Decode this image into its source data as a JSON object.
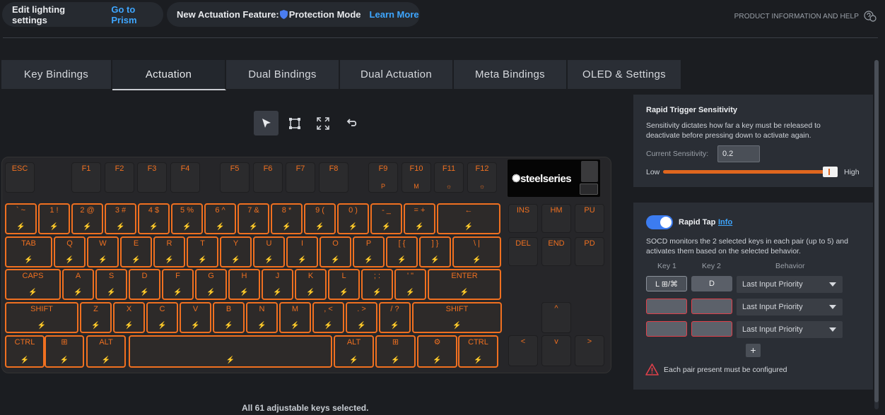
{
  "banner": {
    "lighting_text": "Edit lighting settings",
    "lighting_link": "Go to Prism",
    "feature_prefix": "New Actuation Feature:",
    "feature_name": "Protection Mode",
    "feature_link": "Learn More",
    "help_text": "PRODUCT INFORMATION AND HELP"
  },
  "tabs": [
    {
      "label": "Key Bindings",
      "active": false
    },
    {
      "label": "Actuation",
      "active": true
    },
    {
      "label": "Dual Bindings",
      "active": false
    },
    {
      "label": "Dual Actuation",
      "active": false
    },
    {
      "label": "Meta Bindings",
      "active": false
    },
    {
      "label": "OLED & Settings",
      "active": false
    }
  ],
  "toolbar": [
    "select-pointer-icon",
    "box-select-icon",
    "expand-select-icon",
    "undo-icon"
  ],
  "keyboard": {
    "oled_logo": "steelseries",
    "fn_row": [
      "ESC",
      "F1",
      "F2",
      "F3",
      "F4",
      "F5",
      "F6",
      "F7",
      "F8",
      "F9",
      "F10",
      "F11",
      "F12"
    ],
    "fn_sub": {
      "F9": "P",
      "F10": "M",
      "F11": "☼",
      "F12": "☼"
    },
    "nav_keys": [
      "INS",
      "HM",
      "PU",
      "DEL",
      "END",
      "PD"
    ],
    "row1": [
      "` ~",
      "1 !",
      "2 @",
      "3 #",
      "4 $",
      "5 %",
      "6 ^",
      "7 &",
      "8 *",
      "9 (",
      "0 )",
      "- _",
      "= +",
      "←"
    ],
    "row2": [
      "TAB",
      "Q",
      "W",
      "E",
      "R",
      "T",
      "Y",
      "U",
      "I",
      "O",
      "P",
      "[ {",
      "] }",
      "\\ |"
    ],
    "row3": [
      "CAPS",
      "A",
      "S",
      "D",
      "F",
      "G",
      "H",
      "J",
      "K",
      "L",
      "; :",
      "' \"",
      "ENTER"
    ],
    "row4": [
      "SHIFT",
      "Z",
      "X",
      "C",
      "V",
      "B",
      "N",
      "M",
      ", <",
      ". >",
      "/ ?",
      "SHIFT"
    ],
    "row5": [
      "CTRL",
      "⊞",
      "ALT",
      "",
      "ALT",
      "⊞",
      "⚙",
      "CTRL"
    ],
    "arrows": [
      "^",
      "<",
      "v",
      ">"
    ],
    "bolt": "⚡"
  },
  "status_text": "All 61 adjustable keys selected.",
  "rapid_trigger": {
    "title": "Rapid Trigger Sensitivity",
    "description": "Sensitivity dictates how far a key must be released to deactivate before pressing down to activate again.",
    "current_label": "Current Sensitivity:",
    "current_value": "0.2",
    "low_label": "Low",
    "high_label": "High",
    "slider_level": 0.92
  },
  "rapid_tap": {
    "enabled": true,
    "title": "Rapid Tap",
    "info_link": "Info",
    "description": "SOCD monitors the 2 selected keys in each pair (up to 5) and activates them based on the selected behavior.",
    "headers": {
      "key1": "Key 1",
      "key2": "Key 2",
      "behavior": "Behavior"
    },
    "pairs": [
      {
        "key1": "L ⊞/⌘",
        "key2": "D",
        "behavior": "Last Input Priority"
      },
      {
        "key1": "",
        "key2": "",
        "behavior": "Last Input Priority"
      },
      {
        "key1": "",
        "key2": "",
        "behavior": "Last Input Priority"
      }
    ],
    "add_label": "+",
    "warning": "Each pair present must be configured"
  },
  "colors": {
    "accent": "#f07020",
    "link": "#3ea6ff",
    "toggle": "#3c7cf0",
    "error": "#e0404a"
  }
}
